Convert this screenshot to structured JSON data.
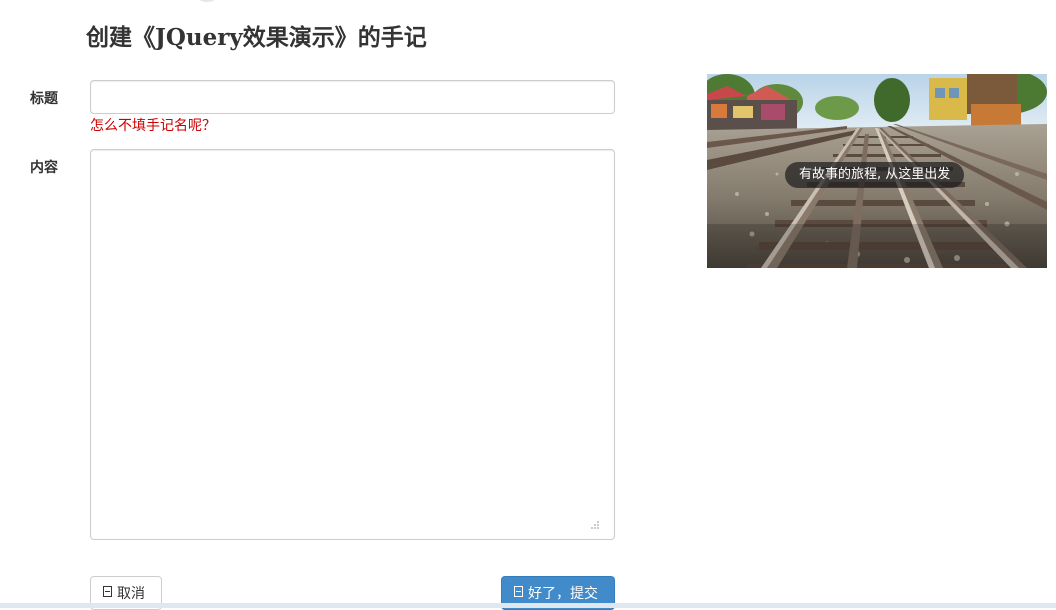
{
  "page": {
    "title": "创建《JQuery效果演示》的手记"
  },
  "form": {
    "title_label": "标题",
    "title_value": "",
    "title_error": "怎么不填手记名呢？",
    "content_label": "内容",
    "content_value": ""
  },
  "buttons": {
    "cancel_label": "取消",
    "submit_label": "好了，提交",
    "cancel_icon": "save-icon",
    "submit_icon": "save-icon"
  },
  "banner": {
    "caption": "有故事的旅程, 从这里出发"
  },
  "colors": {
    "accent": "#428bca",
    "error": "#cc0000",
    "text": "#333333",
    "border": "#cccccc"
  }
}
